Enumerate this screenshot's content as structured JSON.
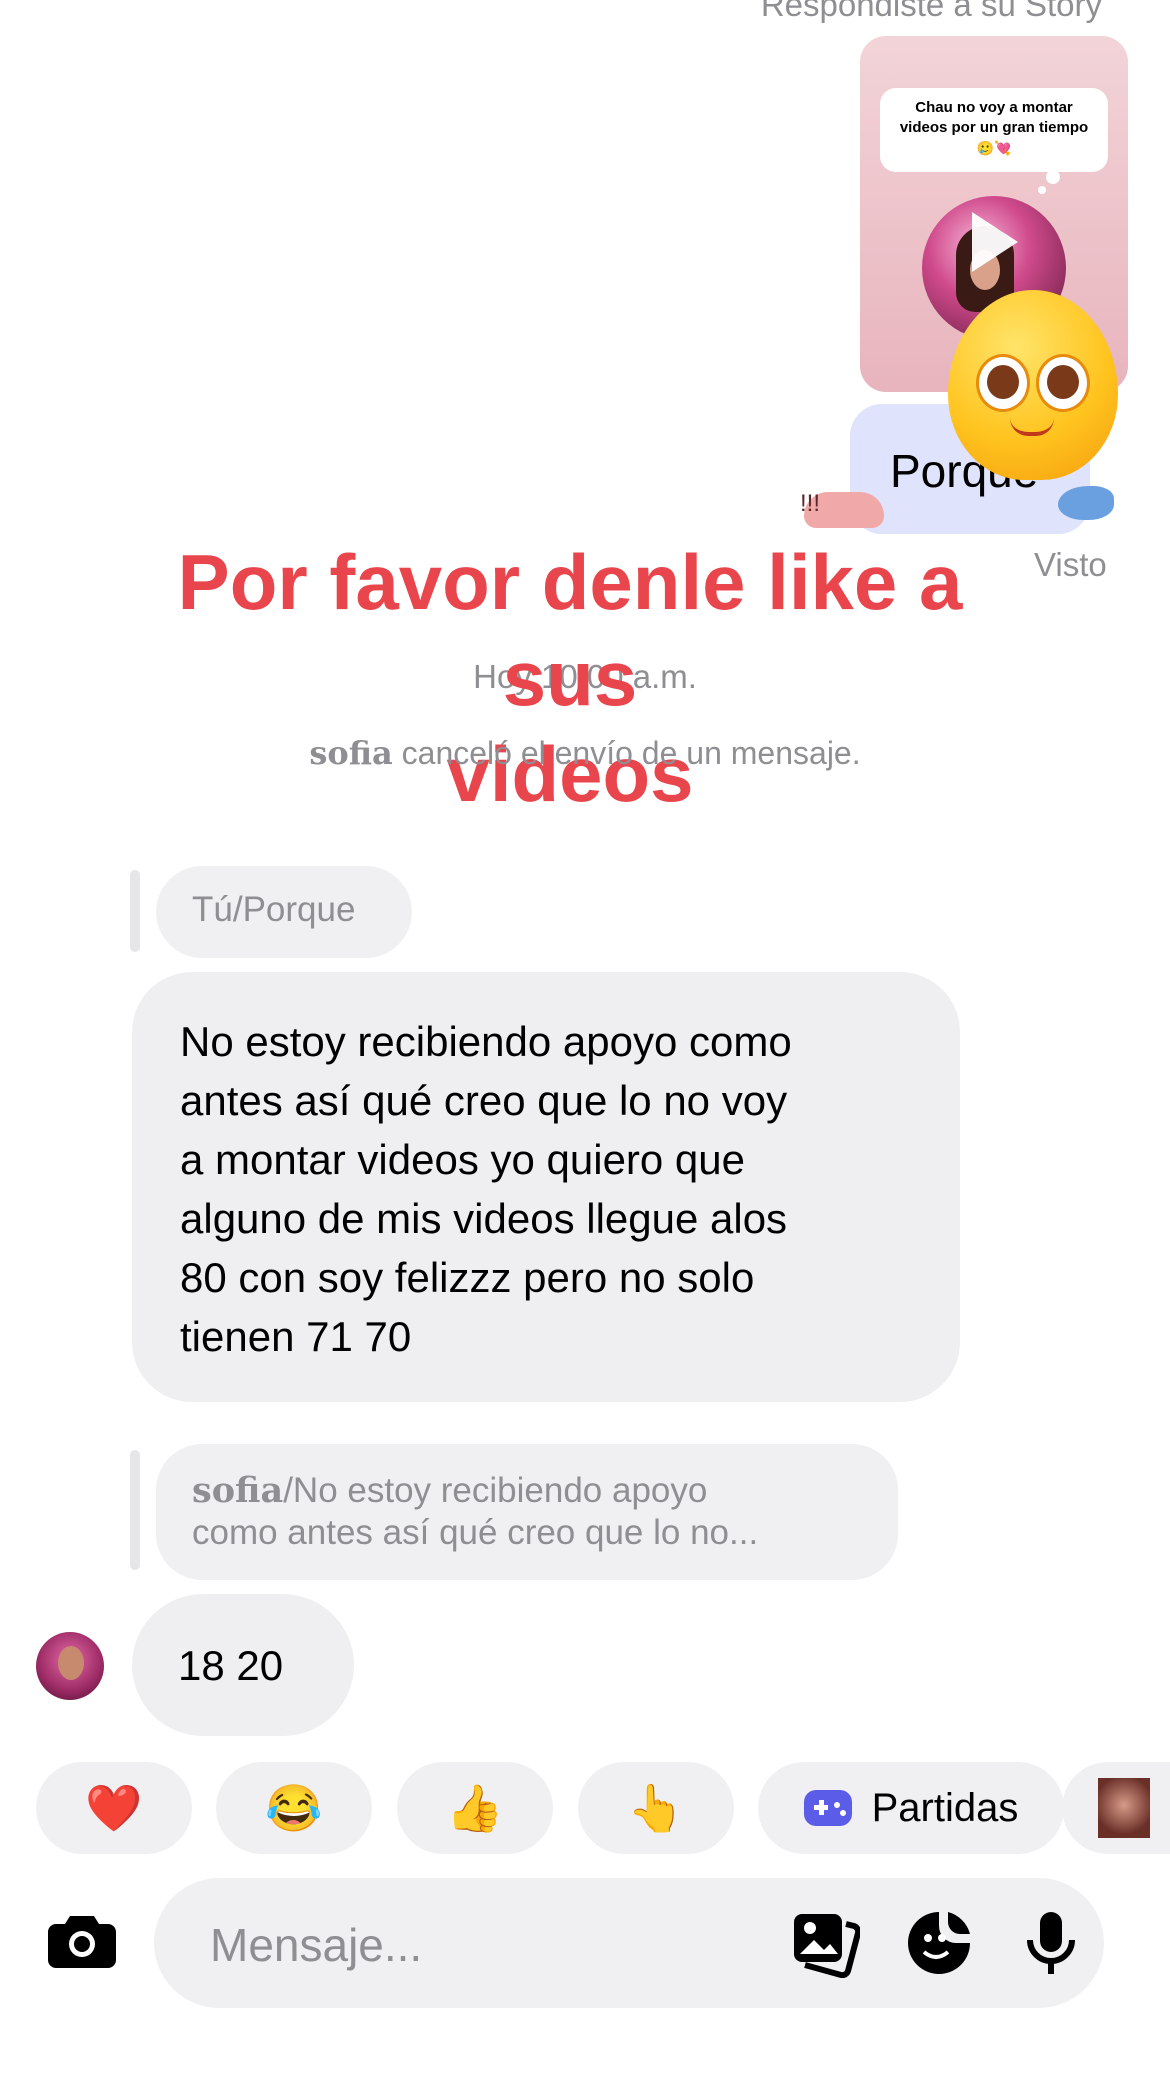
{
  "story": {
    "caption": "Respondiste a su Story",
    "text_line1": "Chau no voy a montar",
    "text_line2": "videos por un gran tiempo",
    "text_emoji": "🥲💘"
  },
  "sent_message": {
    "text": "Porque",
    "sticker_text": "!!!",
    "status": "Visto"
  },
  "overlay_title": {
    "line1": "Por favor denle like a sus",
    "line2": "videos"
  },
  "time_label": "Hoy 10:00 a.m.",
  "cancel_note": {
    "name": "sofia",
    "text": " canceló el envío de un mensaje."
  },
  "reply1": {
    "label": "Tú/Porque"
  },
  "message1": {
    "lines": [
      "No estoy recibiendo apoyo como",
      "antes así qué creo que lo no voy",
      "a montar videos yo quiero que",
      "alguno de mis videos llegue alos",
      "80 con soy felizzz pero no solo",
      "tienen 71 70"
    ]
  },
  "reply2": {
    "name": "sofia",
    "text_line1": "/No estoy recibiendo apoyo",
    "text_line2": "como antes así qué creo que lo no..."
  },
  "message2": {
    "text": "18 20"
  },
  "quick_replies": {
    "heart": "❤️",
    "laugh": "😂",
    "thumbs": "👍",
    "point": "👆",
    "games_label": "Partidas"
  },
  "composer": {
    "placeholder": "Mensaje..."
  },
  "colors": {
    "overlay": "#e8464c",
    "sent_bubble": "#dfe3fb",
    "received_bubble": "#efeff1",
    "games_icon": "#5b5ce8"
  }
}
